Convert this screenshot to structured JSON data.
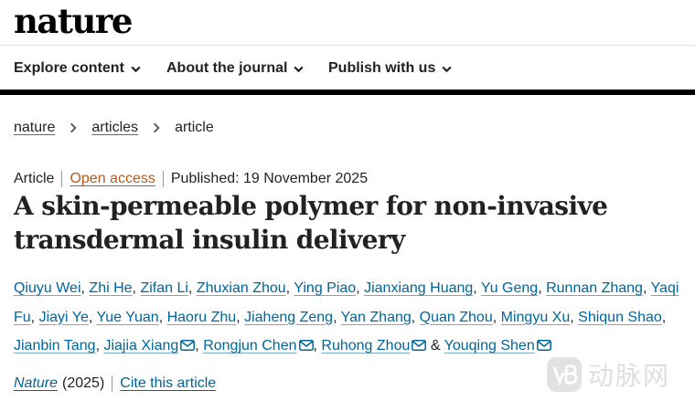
{
  "site": {
    "logo": "nature"
  },
  "nav": {
    "items": [
      {
        "label": "Explore content"
      },
      {
        "label": "About the journal"
      },
      {
        "label": "Publish with us"
      }
    ]
  },
  "breadcrumb": {
    "items": [
      "nature",
      "articles"
    ],
    "current": "article"
  },
  "meta": {
    "type": "Article",
    "access": "Open access",
    "published": "Published: 19 November 2025"
  },
  "article": {
    "title": "A skin-permeable polymer for non-invasive transdermal insulin delivery"
  },
  "authors": [
    "Qiuyu Wei",
    "Zhi He",
    "Zifan Li",
    "Zhuxian Zhou",
    "Ying Piao",
    "Jianxiang Huang",
    "Yu Geng",
    "Runnan Zhang",
    "Yaqi Fu",
    "Jiayi Ye",
    "Yue Yuan",
    "Haoru Zhu",
    "Jiaheng Zeng",
    "Yan Zhang",
    "Quan Zhou",
    "Mingyu Xu",
    "Shiqun Shao",
    "Jianbin Tang",
    "Jiajia Xiang",
    "Rongjun Chen",
    "Ruhong Zhou",
    "Youqing Shen"
  ],
  "authors_sep": {
    "comma": ",",
    "and": "&"
  },
  "citation": {
    "journal": "Nature",
    "year": "(2025)",
    "cite_label": "Cite this article"
  },
  "watermark": {
    "text": "动脉网"
  },
  "colors": {
    "link": "#006699",
    "open_access": "#b35a1f",
    "rule": "#000000"
  }
}
